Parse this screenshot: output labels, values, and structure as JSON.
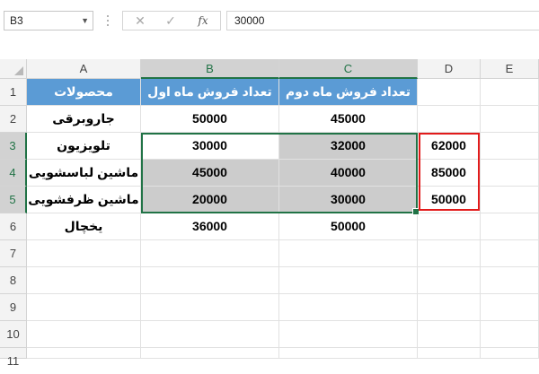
{
  "formula_bar": {
    "name_box": "B3",
    "cancel_symbol": "✕",
    "enter_symbol": "✓",
    "fx_label": "fx",
    "formula_value": "30000"
  },
  "columns": [
    "A",
    "B",
    "C",
    "D",
    "E"
  ],
  "rows": [
    "1",
    "2",
    "3",
    "4",
    "5",
    "6",
    "7",
    "8",
    "9",
    "10",
    "11"
  ],
  "cells": {
    "A1": "محصولات",
    "B1": "تعداد فروش ماه اول",
    "C1": "تعداد فروش ماه دوم",
    "A2": "جاروبرقی",
    "B2": "50000",
    "C2": "45000",
    "A3": "تلویزیون",
    "B3": "30000",
    "C3": "32000",
    "D3": "62000",
    "A4": "ماشین لباسشویی",
    "B4": "45000",
    "C4": "40000",
    "D4": "85000",
    "A5": "ماشین ظرفشویی",
    "B5": "20000",
    "C5": "30000",
    "D5": "50000",
    "A6": "یخچال",
    "B6": "36000",
    "C6": "50000"
  },
  "colors": {
    "header_fill": "#5b9bd5",
    "shaded_fill": "#cccccc",
    "selection_border": "#217346",
    "highlight_border": "#e21b1b"
  }
}
